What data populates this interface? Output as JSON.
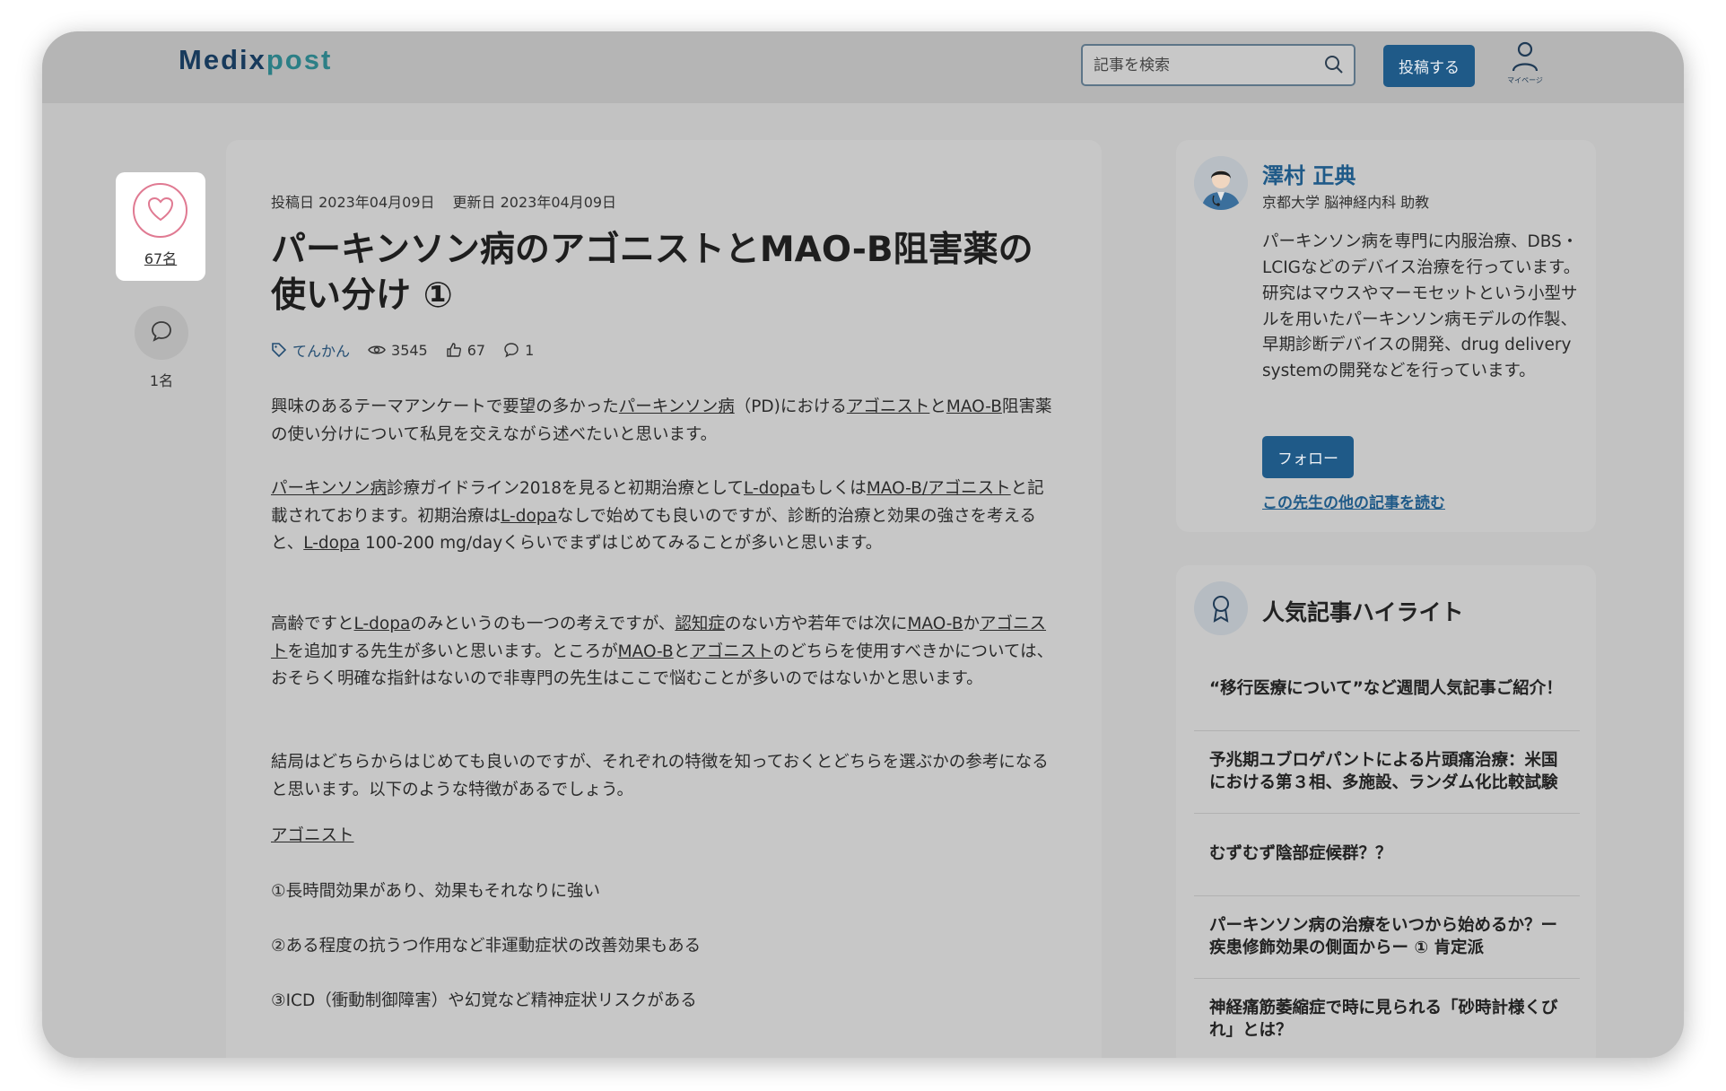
{
  "header": {
    "logo_part1": "Medix",
    "logo_part2": "post",
    "search_placeholder": "記事を検索",
    "post_button": "投稿する",
    "mypage_label": "マイページ"
  },
  "sidebar_actions": {
    "like_count": "67名",
    "comment_count": "1名"
  },
  "article": {
    "posted": "投稿日 2023年04月09日",
    "updated": "更新日 2023年04月09日",
    "title": "パーキンソン病のアゴニストとMAO-B阻害薬の使い分け ①",
    "tag": "てんかん",
    "views": "3545",
    "likes": "67",
    "comments": "1",
    "p1": [
      "興味のあるテーマアンケートで要望の多かった",
      "パーキンソン病",
      "（PD)における",
      "アゴニスト",
      "と",
      "MAO-B",
      "阻害薬の使い分けについて私見を交えながら述べたいと思います。"
    ],
    "p2": [
      "パーキンソン病",
      "診療ガイドライン2018を見ると初期治療として",
      "L-dopa",
      "もしくは",
      "MAO-B/アゴニスト",
      "と記載されております。初期治療は",
      "L-dopa",
      "なしで始めても良いのですが、診断的治療と効果の強さを考えると、",
      "L-dopa",
      " 100-200 mg/dayくらいでまずはじめてみることが多いと思います。"
    ],
    "p3": [
      "高齢ですと",
      "L-dopa",
      "のみというのも一つの考えですが、",
      "認知症",
      "のない方や若年では次に",
      "MAO-B",
      "か",
      "アゴニスト",
      "を追加する先生が多いと思います。ところが",
      "MAO-B",
      "と",
      "アゴニスト",
      "のどちらを使用すべきかについては、おそらく明確な指針はないので非専門の先生はここで悩むことが多いのではないかと思います。"
    ],
    "p4": "結局はどちらからはじめても良いのですが、それぞれの特徴を知っておくとどちらを選ぶかの参考になると思います。以下のような特徴があるでしょう。",
    "heading": "アゴニスト",
    "item1": "①長時間効果があり、効果もそれなりに強い",
    "item2": "②ある程度の抗うつ作用など非運動症状の改善効果もある",
    "item3": "③ICD（衝動制御障害）や幻覚など精神症状リスクがある"
  },
  "author": {
    "name": "澤村 正典",
    "affiliation": "京都大学 脳神経内科 助教",
    "bio": "パーキンソン病を専門に内服治療、DBS・LCIGなどのデバイス治療を行っています。研究はマウスやマーモセットという小型サルを用いたパーキンソン病モデルの作製、早期診断デバイスの開発、drug delivery systemの開発などを行っています。",
    "follow_button": "フォロー",
    "more_link": "この先生の他の記事を読む"
  },
  "popular": {
    "title": "人気記事ハイライト",
    "items": [
      "“移行医療について”など週間人気記事ご紹介！",
      "予兆期ユブロゲパントによる片頭痛治療：米国における第３相、多施設、ランダム化比較試験",
      "むずむず陰部症候群？？",
      "パーキンソン病の治療をいつから始めるか？ー疾患修飾効果の側面からー ① 肯定派",
      "神経痛筋萎縮症で時に見られる「砂時計様くびれ」とは？"
    ]
  },
  "colors": {
    "accent": "#1f5a88",
    "overlay_bg": "#c2c2c2",
    "like": "#e07a92"
  }
}
